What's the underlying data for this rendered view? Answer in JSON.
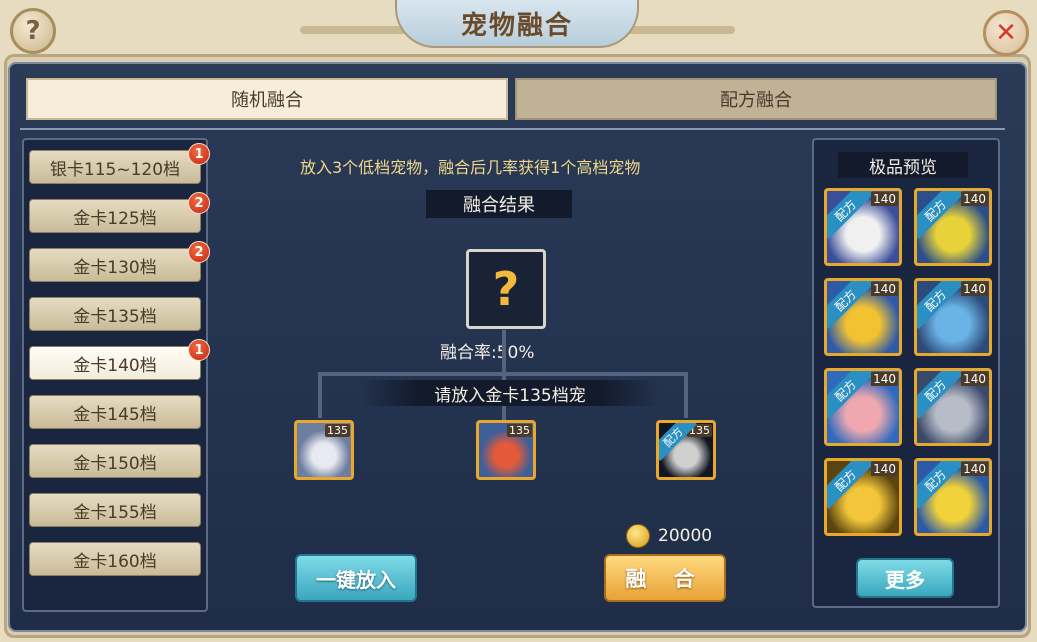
{
  "title": "宠物融合",
  "help_label": "?",
  "close_label": "✕",
  "tabs": [
    {
      "label": "随机融合",
      "active": true
    },
    {
      "label": "配方融合",
      "active": false
    }
  ],
  "tiers": [
    {
      "label": "银卡115~120档",
      "badge": "1"
    },
    {
      "label": "金卡125档",
      "badge": "2"
    },
    {
      "label": "金卡130档",
      "badge": "2"
    },
    {
      "label": "金卡135档",
      "badge": ""
    },
    {
      "label": "金卡140档",
      "badge": "1"
    },
    {
      "label": "金卡145档",
      "badge": ""
    },
    {
      "label": "金卡150档",
      "badge": ""
    },
    {
      "label": "金卡155档",
      "badge": ""
    },
    {
      "label": "金卡160档",
      "badge": ""
    }
  ],
  "selected_tier_index": 4,
  "main": {
    "hint": "放入3个低档宠物，融合后几率获得1个高档宠物",
    "result_label": "融合结果",
    "result_placeholder": "?",
    "rate": "融合率:50%",
    "need_label": "请放入金卡135档宠",
    "slots": [
      {
        "level": "135",
        "recipe": false,
        "colors": [
          "#6d7ea0",
          "#e9e9f2"
        ]
      },
      {
        "level": "135",
        "recipe": false,
        "colors": [
          "#3e5f9a",
          "#e25a3a"
        ]
      },
      {
        "level": "135",
        "recipe": true,
        "recipe_label": "配方",
        "colors": [
          "#111722",
          "#cfcfcf"
        ]
      }
    ],
    "cost_value": "20000",
    "auto_button": "一键放入",
    "fuse_button": "融 合"
  },
  "preview": {
    "title": "极品预览",
    "items": [
      {
        "level": "140",
        "tag": "配方",
        "colors": [
          "#3a4f9a",
          "#f0f0f0"
        ]
      },
      {
        "level": "140",
        "tag": "配方",
        "colors": [
          "#2a4f8a",
          "#e7d23a"
        ]
      },
      {
        "level": "140",
        "tag": "配方",
        "colors": [
          "#2e5aa8",
          "#f3c233"
        ]
      },
      {
        "level": "140",
        "tag": "配方",
        "colors": [
          "#2c4a7a",
          "#6ab3e6"
        ]
      },
      {
        "level": "140",
        "tag": "配方",
        "colors": [
          "#2f6bbd",
          "#f0a8b0"
        ]
      },
      {
        "level": "140",
        "tag": "配方",
        "colors": [
          "#3a4a6a",
          "#b8bcc8"
        ]
      },
      {
        "level": "140",
        "tag": "配方",
        "colors": [
          "#5a4510",
          "#f2c53a"
        ]
      },
      {
        "level": "140",
        "tag": "配方",
        "colors": [
          "#2a5aa8",
          "#f2d23a"
        ]
      }
    ],
    "more_button": "更多"
  }
}
